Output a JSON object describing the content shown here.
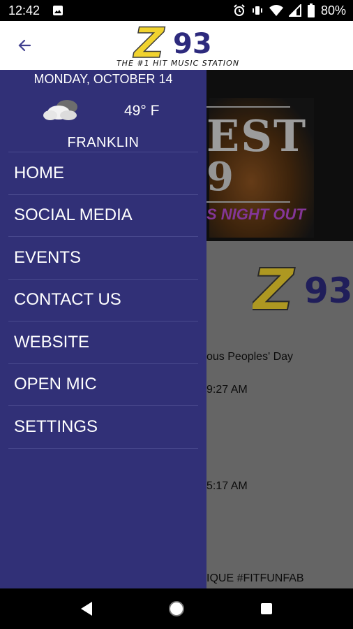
{
  "status_bar": {
    "time": "12:42",
    "battery": "80%"
  },
  "header": {
    "tagline": "THE #1 HIT MUSIC STATION",
    "logo_letter": "Z",
    "logo_number": "93"
  },
  "weather": {
    "date": "MONDAY, OCTOBER 14",
    "temperature": "49° F",
    "city": "FRANKLIN"
  },
  "menu": {
    "items": [
      {
        "label": "HOME"
      },
      {
        "label": "SOCIAL MEDIA"
      },
      {
        "label": "EVENTS"
      },
      {
        "label": "CONTACT US"
      },
      {
        "label": "WEBSITE"
      },
      {
        "label": "OPEN MIC"
      },
      {
        "label": "SETTINGS"
      }
    ]
  },
  "background": {
    "banner_line1": "EST",
    "banner_line2": "9",
    "banner_subtitle": "S NIGHT OUT",
    "logo_letter": "Z",
    "logo_number": "93",
    "texts": [
      "ous Peoples' Day",
      "9:27 AM",
      "5:17 AM",
      "IQUE #FITFUNFAB"
    ]
  },
  "colors": {
    "drawer": "#313077",
    "logo_yellow": "#f1d32f",
    "logo_purple": "#2d2a7d",
    "accent_purple": "#b64bd1"
  }
}
